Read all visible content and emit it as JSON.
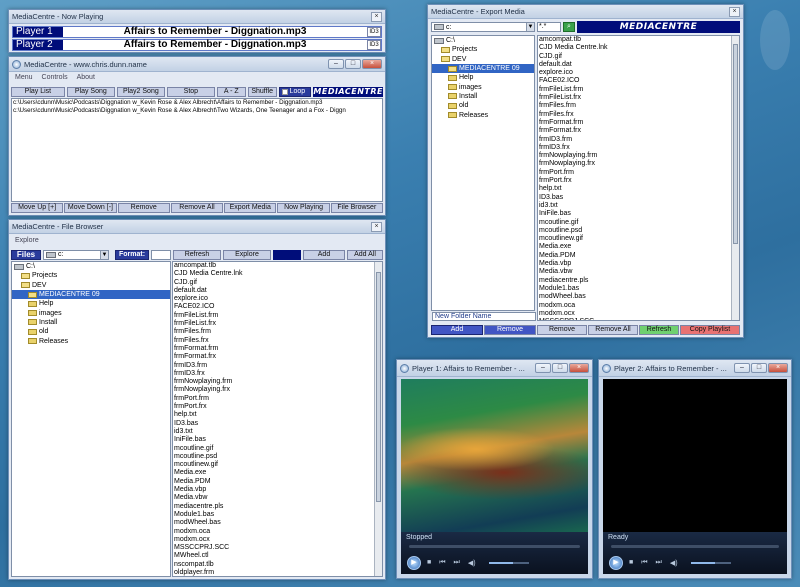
{
  "now_playing": {
    "title": "MediaCentre - Now Playing",
    "player1_label": "Player 1",
    "player1_track": "Affairs to Remember - Diggnation.mp3",
    "player2_label": "Player 2",
    "player2_track": "Affairs to Remember - Diggnation.mp3",
    "id3_label": "ID3"
  },
  "main": {
    "title": "MediaCentre - www.chris.dunn.name",
    "menu": [
      "Menu",
      "Controls",
      "About"
    ],
    "toolbar": [
      "Play List",
      "Play Song",
      "Play2 Song",
      "Stop",
      "A - Z",
      "Shuffle"
    ],
    "loop_label": "Loop",
    "logo": "MEDIACENTRE",
    "playlist": [
      "c:\\Users\\cdunn\\Music\\Podcasts\\Diggnation w_Kevin Rose & Alex Albrecht\\Affairs to Remember - Diggnation.mp3",
      "c:\\Users\\cdunn\\Music\\Podcasts\\Diggnation w_Kevin Rose & Alex Albrecht\\Two Wizards, One Teenager and a Fox - Diggn"
    ],
    "bottom_buttons": [
      "Move Up [+]",
      "Move Down [-]",
      "Remove",
      "Remove All",
      "Export Media",
      "Now Playing",
      "File Browser"
    ]
  },
  "file_browser": {
    "title": "MediaCentre - File Browser",
    "menu": "Explore",
    "files_label": "Files",
    "drive": "c:",
    "format_label": "Format:",
    "buttons": [
      "Refresh",
      "Explore",
      "Add",
      "Add All"
    ],
    "tree": [
      {
        "name": "C:\\",
        "depth": 0,
        "type": "drive",
        "selected": false
      },
      {
        "name": "Projects",
        "depth": 1,
        "type": "folder",
        "selected": false
      },
      {
        "name": "DEV",
        "depth": 1,
        "type": "folder",
        "selected": false
      },
      {
        "name": "MEDIACENTRE 09",
        "depth": 2,
        "type": "folder",
        "selected": true
      },
      {
        "name": "Help",
        "depth": 2,
        "type": "folder",
        "selected": false
      },
      {
        "name": "images",
        "depth": 2,
        "type": "folder",
        "selected": false
      },
      {
        "name": "Install",
        "depth": 2,
        "type": "folder",
        "selected": false
      },
      {
        "name": "old",
        "depth": 2,
        "type": "folder",
        "selected": false
      },
      {
        "name": "Releases",
        "depth": 2,
        "type": "folder",
        "selected": false
      }
    ],
    "files": [
      "amcompat.tlb",
      "CJD Media Centre.lnk",
      "CJD.gif",
      "default.dat",
      "explore.ico",
      "FACE02.ICO",
      "frmFileList.frm",
      "frmFileList.frx",
      "frmFiles.frm",
      "frmFiles.frx",
      "frmFormat.frm",
      "frmFormat.frx",
      "frmID3.frm",
      "frmID3.frx",
      "frmNowplaying.frm",
      "frmNowplaying.frx",
      "frmPort.frm",
      "frmPort.frx",
      "help.txt",
      "ID3.bas",
      "id3.txt",
      "IniFile.bas",
      "mcoutline.gif",
      "mcoutline.psd",
      "mcoutlinew.gif",
      "Media.exe",
      "Media.PDM",
      "Media.vbp",
      "Media.vbw",
      "mediacentre.pls",
      "Module1.bas",
      "modWheel.bas",
      "modxm.oca",
      "modxm.ocx",
      "MSSCCPRJ.SCC",
      "MWheel.ctl",
      "nscompat.tlb",
      "oldplayer.frm",
      "oldplayer.frx"
    ]
  },
  "export_media": {
    "title": "MediaCentre - Export Media",
    "drive": "c:",
    "filter": "*.*",
    "logo": "MEDIACENTRE",
    "tree": [
      {
        "name": "C:\\",
        "depth": 0,
        "type": "drive",
        "selected": false
      },
      {
        "name": "Projects",
        "depth": 1,
        "type": "folder",
        "selected": false
      },
      {
        "name": "DEV",
        "depth": 1,
        "type": "folder",
        "selected": false
      },
      {
        "name": "MEDIACENTRE 09",
        "depth": 2,
        "type": "folder",
        "selected": true
      },
      {
        "name": "Help",
        "depth": 2,
        "type": "folder",
        "selected": false
      },
      {
        "name": "images",
        "depth": 2,
        "type": "folder",
        "selected": false
      },
      {
        "name": "Install",
        "depth": 2,
        "type": "folder",
        "selected": false
      },
      {
        "name": "old",
        "depth": 2,
        "type": "folder",
        "selected": false
      },
      {
        "name": "Releases",
        "depth": 2,
        "type": "folder",
        "selected": false
      }
    ],
    "new_folder_label": "New Folder Name",
    "files": [
      "amcompat.tlb",
      "CJD Media Centre.lnk",
      "CJD.gif",
      "default.dat",
      "explore.ico",
      "FACE02.ICO",
      "frmFileList.frm",
      "frmFileList.frx",
      "frmFiles.frm",
      "frmFiles.frx",
      "frmFormat.frm",
      "frmFormat.frx",
      "frmID3.frm",
      "frmID3.frx",
      "frmNowplaying.frm",
      "frmNowplaying.frx",
      "frmPort.frm",
      "frmPort.frx",
      "help.txt",
      "ID3.bas",
      "id3.txt",
      "IniFile.bas",
      "mcoutline.gif",
      "mcoutline.psd",
      "mcoutlinew.gif",
      "Media.exe",
      "Media.PDM",
      "Media.vbp",
      "Media.vbw",
      "mediacentre.pls",
      "Module1.bas",
      "modWheel.bas",
      "modxm.oca",
      "modxm.ocx",
      "MSSCCPRJ.SCC"
    ],
    "buttons": [
      "Add",
      "Remove",
      "Remove",
      "Remove All",
      "Refresh",
      "Copy Playlist"
    ]
  },
  "player1": {
    "title": "Player 1: Affairs to Remember - ...",
    "status": "Stopped"
  },
  "player2": {
    "title": "Player 2: Affairs to Remember - ...",
    "status": "Ready"
  },
  "colors": {
    "accent_dark": "#000d7a",
    "selection": "#3165c4",
    "refresh_btn": "#6fd06f",
    "copy_playlist_btn": "#e87272"
  }
}
